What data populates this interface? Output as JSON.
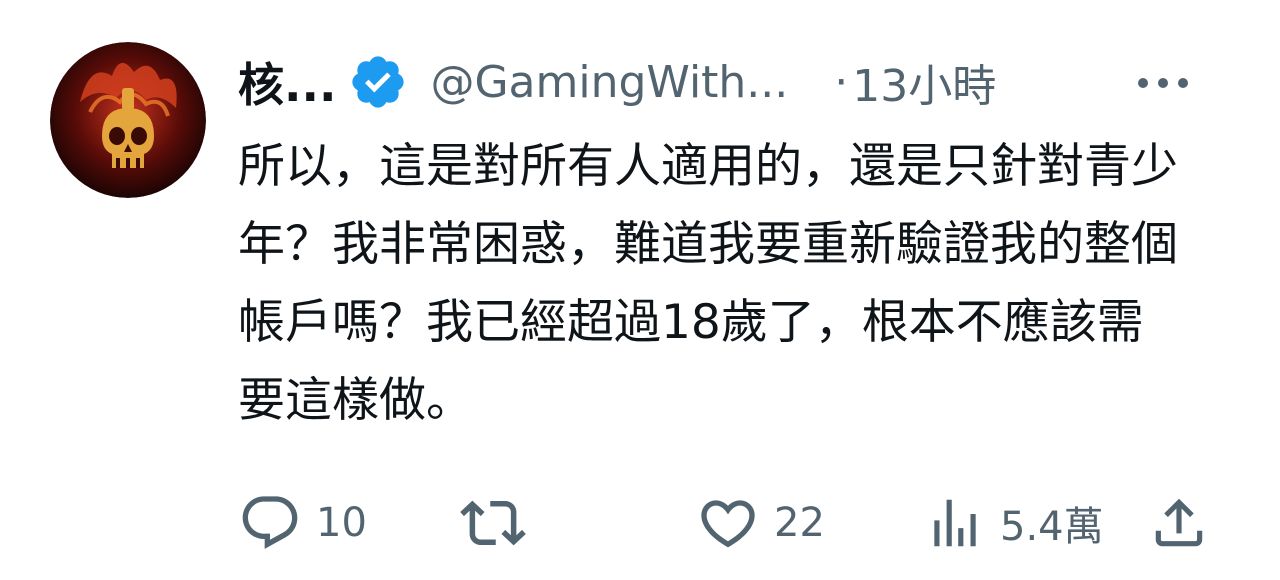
{
  "tweet": {
    "display_name": "核...",
    "handle": "@GamingWith...",
    "separator": "·",
    "time": "13小時",
    "text": "所以，這是對所有人適用的，還是只針對青少年？我非常困惑，難道我要重新驗證我的整個帳戶嗎？我已經超過18歲了，根本不應該需要這樣做。",
    "verified": true
  },
  "actions": {
    "replies": "10",
    "retweets": "",
    "likes": "22",
    "views": "5.4萬"
  },
  "colors": {
    "verified_blue": "#1d9bf0",
    "secondary_text": "#536471",
    "primary_text": "#0f1419"
  },
  "icons": {
    "verified": "verified-badge-icon",
    "more": "more-icon",
    "reply": "reply-icon",
    "retweet": "retweet-icon",
    "like": "heart-icon",
    "views": "views-icon",
    "share": "share-icon"
  }
}
